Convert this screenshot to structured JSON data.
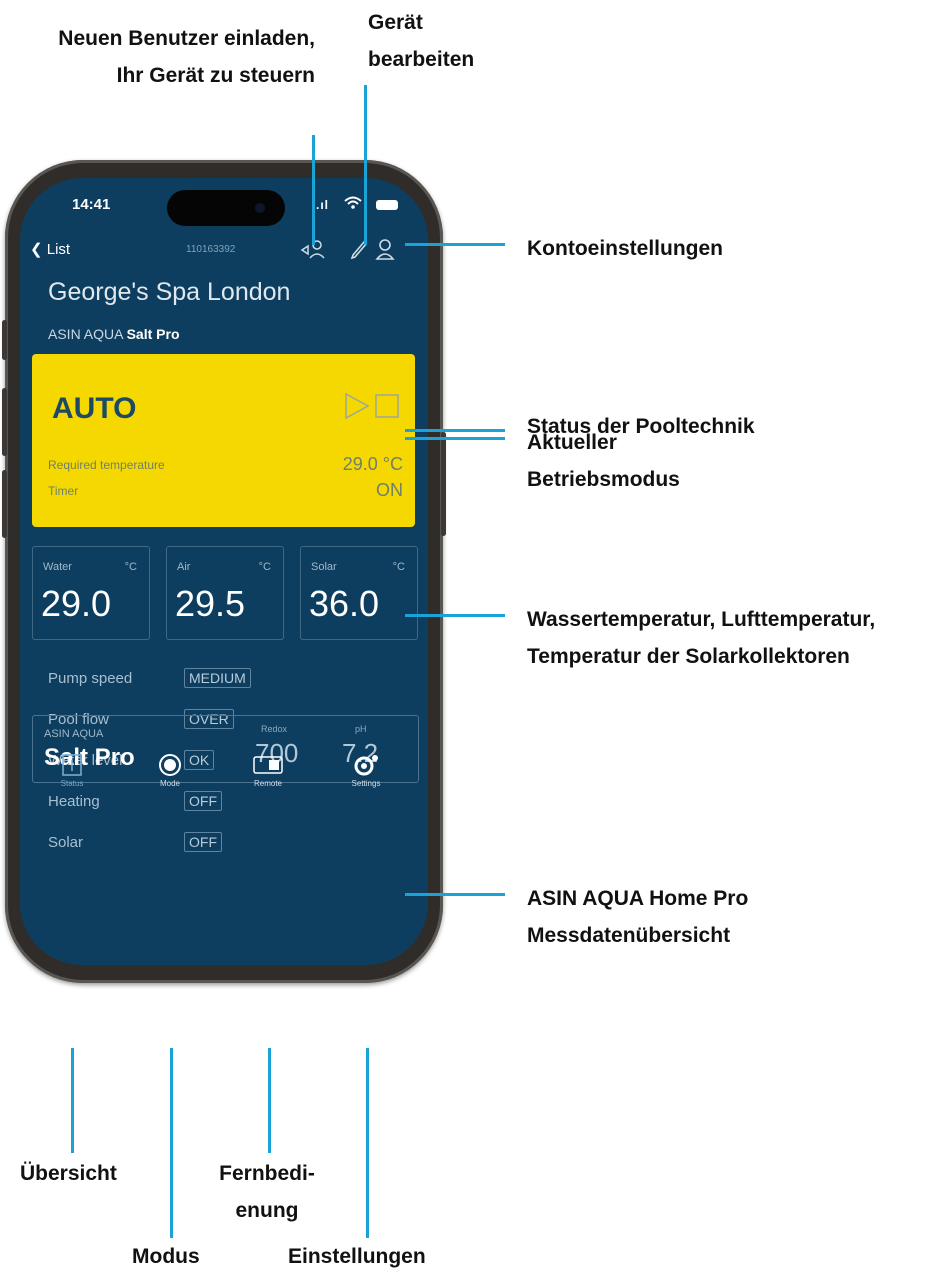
{
  "callouts": {
    "invite": "Neuen Benutzer einladen, Ihr Gerät zu steuern",
    "edit_device": "Gerät bearbeiten",
    "account": "Kontoeinstellungen",
    "current_mode": "Aktueller Betriebsmodus",
    "temperatures": "Wassertemperatur, Lufttemperatur, Temperatur der Solarkollektoren",
    "pool_status": "Status der Pooltechnik",
    "measurement": "ASIN AQUA Home Pro Messdatenübersicht",
    "overview": "Übersicht",
    "remote": "Fernbedi-enung",
    "mode": "Modus",
    "settings": "Einstellungen"
  },
  "phone": {
    "status_bar": {
      "time": "14:41",
      "signal": ".ıl"
    },
    "header": {
      "back_label": "List",
      "serial": "110163392"
    },
    "device_name": "George's Spa London",
    "model_prefix": "ASIN AQUA",
    "model_name": "Salt Pro",
    "mode_card": {
      "mode": "AUTO",
      "required_temperature_label": "Required temperature",
      "required_temperature_value": "29.0 °C",
      "timer_label": "Timer",
      "timer_value": "ON",
      "background_color": "#f5d800"
    },
    "temperatures": [
      {
        "label": "Water",
        "unit": "°C",
        "value": "29.0"
      },
      {
        "label": "Air",
        "unit": "°C",
        "value": "29.5"
      },
      {
        "label": "Solar",
        "unit": "°C",
        "value": "36.0"
      }
    ],
    "status": [
      {
        "label": "Pump speed",
        "value": "MEDIUM"
      },
      {
        "label": "Pool flow",
        "value": "OVER"
      },
      {
        "label": "Water level",
        "value": "OK"
      },
      {
        "label": "Heating",
        "value": "OFF"
      },
      {
        "label": "Solar",
        "value": "OFF"
      }
    ],
    "salt_card": {
      "brand": "ASIN AQUA",
      "model": "Salt Pro",
      "redox_label": "Redox",
      "redox_value": "700",
      "ph_label": "pH",
      "ph_value": "7.2"
    },
    "bottom_nav": [
      {
        "label": "Status",
        "icon": "info-icon"
      },
      {
        "label": "Mode",
        "icon": "mode-icon"
      },
      {
        "label": "Remote",
        "icon": "remote-icon"
      },
      {
        "label": "Settings",
        "icon": "gear-icon"
      }
    ]
  },
  "colors": {
    "screen": "#0e3e5f",
    "accent_line": "#1aa3d6",
    "mode_card": "#f5d800"
  }
}
